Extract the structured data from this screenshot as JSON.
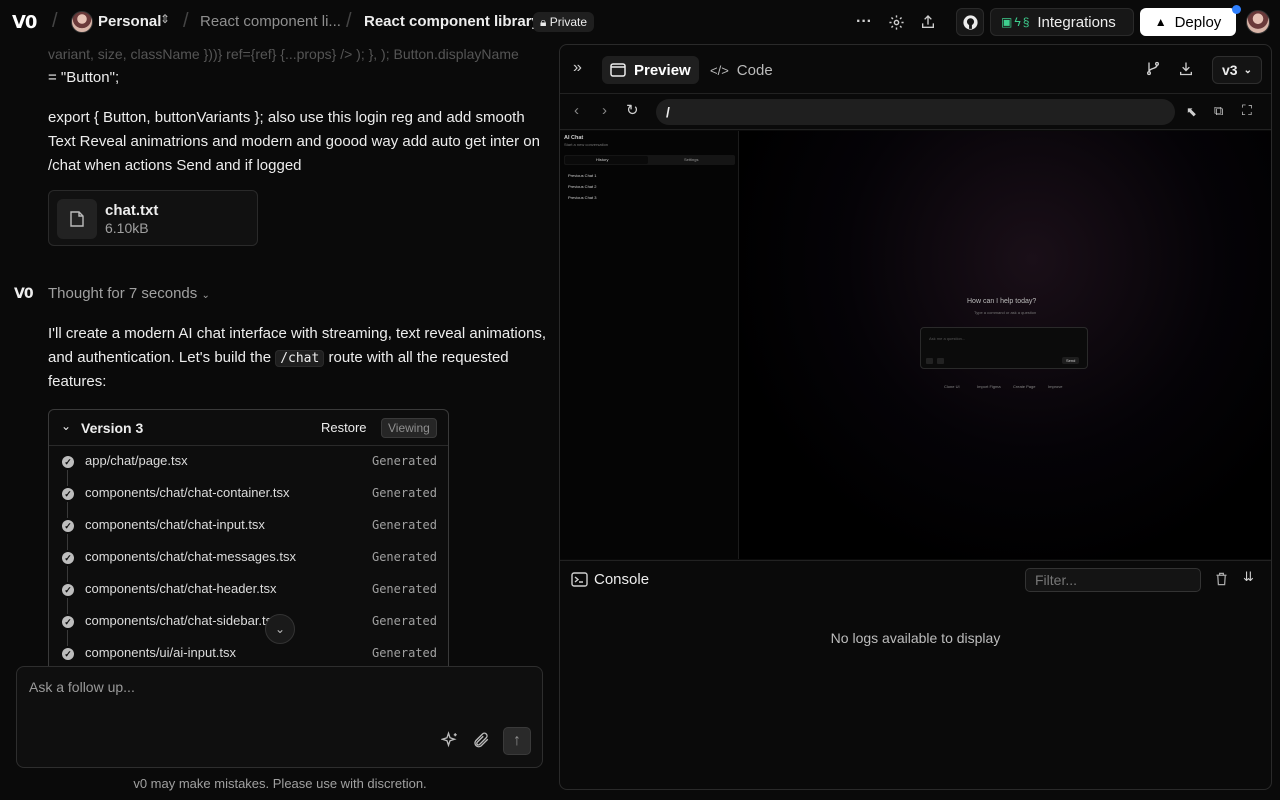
{
  "topbar": {
    "logo": "V0",
    "workspace": "Personal",
    "project_truncated": "React component li...",
    "chat_title": "React component library",
    "visibility": "Private",
    "integrations_label": "Integrations",
    "deploy_label": "Deploy"
  },
  "chat": {
    "faded_text": "variant, size, className }))} ref={ref} {...props} /> ); }, ); Button.displayName",
    "line_button_name": "= \"Button\";",
    "user_message": [
      "export { Button, buttonVariants }; also use this login reg and add smooth",
      "Text Reveal animatrions and modern and goood way add auto get inter on",
      "/chat when actions Send and if logged"
    ],
    "attachment": {
      "name": "chat.txt",
      "size": "6.10kB"
    },
    "assistant_logo": "V0",
    "thought_label": "Thought for 7 seconds",
    "response_line1": "I'll create a modern AI chat interface with streaming, text reveal animations,",
    "response_line2_pre": "and authentication. Let's build the",
    "response_code": "/chat",
    "response_line2_post": "route with all the requested",
    "response_line3": "features:",
    "version": {
      "title": "Version 3",
      "restore_label": "Restore",
      "viewing_label": "Viewing",
      "files": [
        {
          "path": "app/chat/page.tsx",
          "status": "Generated"
        },
        {
          "path": "components/chat/chat-container.tsx",
          "status": "Generated"
        },
        {
          "path": "components/chat/chat-input.tsx",
          "status": "Generated"
        },
        {
          "path": "components/chat/chat-messages.tsx",
          "status": "Generated"
        },
        {
          "path": "components/chat/chat-header.tsx",
          "status": "Generated"
        },
        {
          "path": "components/chat/chat-sidebar.tsx",
          "status": "Generated"
        },
        {
          "path": "components/ui/ai-input.tsx",
          "status": "Generated"
        }
      ]
    },
    "input_placeholder": "Ask a follow up...",
    "disclaimer": "v0 may make mistakes. Please use with discretion."
  },
  "preview_panel": {
    "tab_preview": "Preview",
    "tab_code": "Code",
    "version_select": "v3",
    "url": "/",
    "app": {
      "sidebar_title": "AI Chat",
      "sidebar_subtitle": "Start a new conversation",
      "tab_history": "History",
      "tab_settings": "Settings",
      "chats": [
        "Previous Chat 1",
        "Previous Chat 2",
        "Previous Chat 3"
      ],
      "heading": "How can I help today?",
      "subheading": "Type a command or ask a question",
      "input_placeholder": "Ask me a question...",
      "send_label": "Send",
      "chips": [
        "Clone UI",
        "Import Figma",
        "Create Page",
        "Improve"
      ]
    },
    "console": {
      "title": "Console",
      "filter_placeholder": "Filter...",
      "empty": "No logs available to display"
    }
  },
  "colors": {
    "background": "#0a0a0a",
    "accent_blue": "#2f80ff",
    "deploy_bg": "#ffffff"
  }
}
